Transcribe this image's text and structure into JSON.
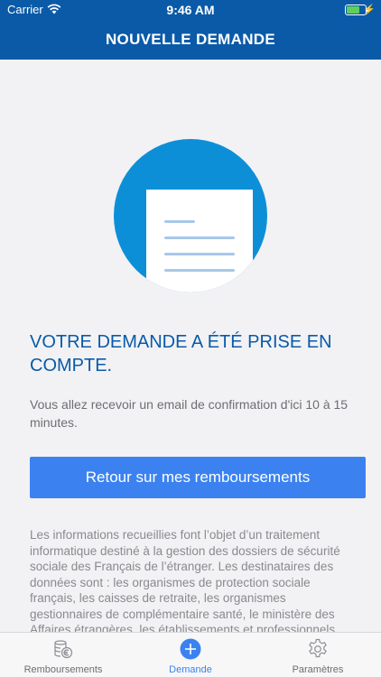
{
  "status_bar": {
    "carrier": "Carrier",
    "time": "9:46 AM"
  },
  "nav": {
    "title": "NOUVELLE DEMANDE"
  },
  "confirmation": {
    "title": "VOTRE DEMANDE A ÉTÉ PRISE EN COMPTE.",
    "message": "Vous allez recevoir un email de confirmation d'ici 10 à 15 minutes."
  },
  "actions": {
    "back_label": "Retour sur mes remboursements"
  },
  "legal": {
    "text": "Les informations recueillies font l’objet d’un traitement informatique destiné à la gestion des dossiers de sécurité sociale des Français de l’étranger. Les destinataires des données sont : les organismes de protection sociale français, les caisses de retraite, les organismes gestionnaires de complémentaire santé, le ministère des Affaires étrangères, les établissements et professionnels"
  },
  "tabbar": {
    "items": [
      {
        "label": "Remboursements",
        "icon": "coins-euro-icon",
        "active": false
      },
      {
        "label": "Demande",
        "icon": "plus-circle-icon",
        "active": true
      },
      {
        "label": "Paramètres",
        "icon": "gear-icon",
        "active": false
      }
    ]
  },
  "colors": {
    "header": "#0a5aa8",
    "accent": "#3b82f0",
    "hero_circle": "#0d8fd8",
    "title": "#0a5aa8"
  }
}
